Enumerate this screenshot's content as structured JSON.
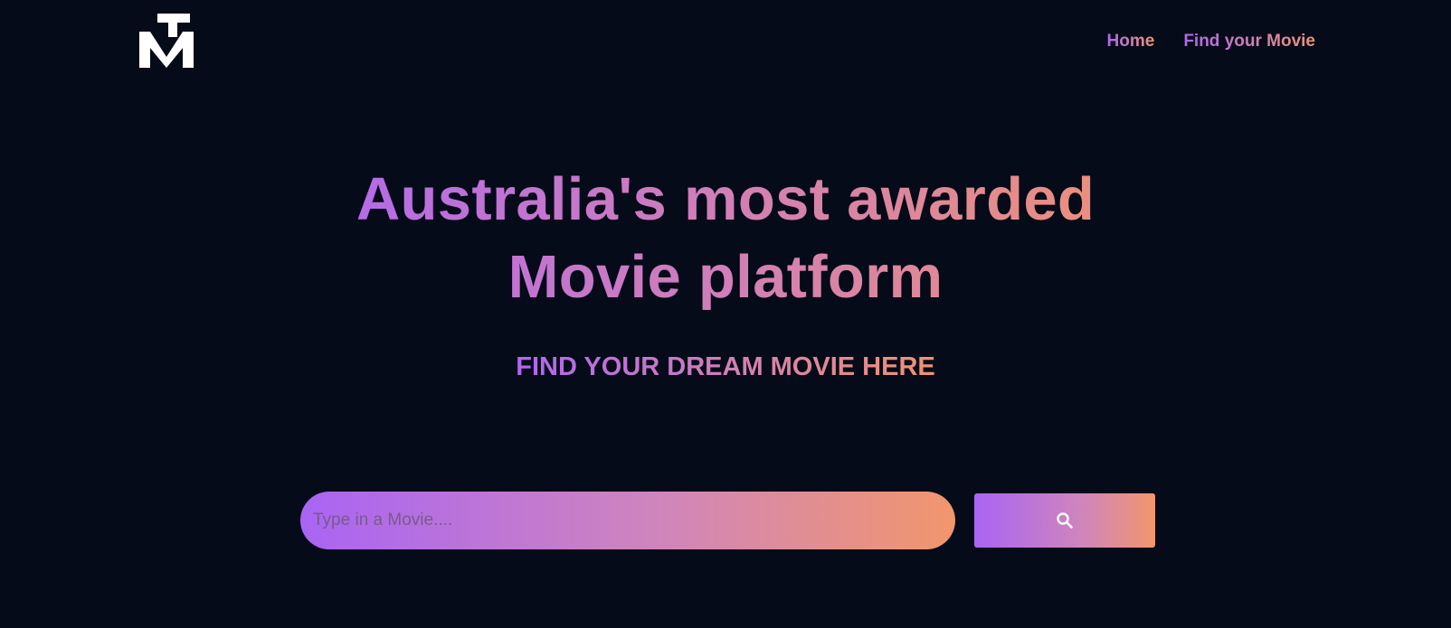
{
  "colors": {
    "background": "#050b18",
    "gradient_start": "#b066f2",
    "gradient_mid": "#d17fb7",
    "gradient_end": "#f09371",
    "logo": "#ffffff"
  },
  "header": {
    "logo_icon": "tm-logo-icon",
    "nav": {
      "home_label": "Home",
      "find_label": "Find your Movie"
    }
  },
  "hero": {
    "title": "Australia's most awarded Movie platform",
    "subtitle": "FIND YOUR DREAM MOVIE HERE"
  },
  "search": {
    "placeholder": "Type in a Movie....",
    "value": "",
    "button_icon": "search-icon"
  }
}
